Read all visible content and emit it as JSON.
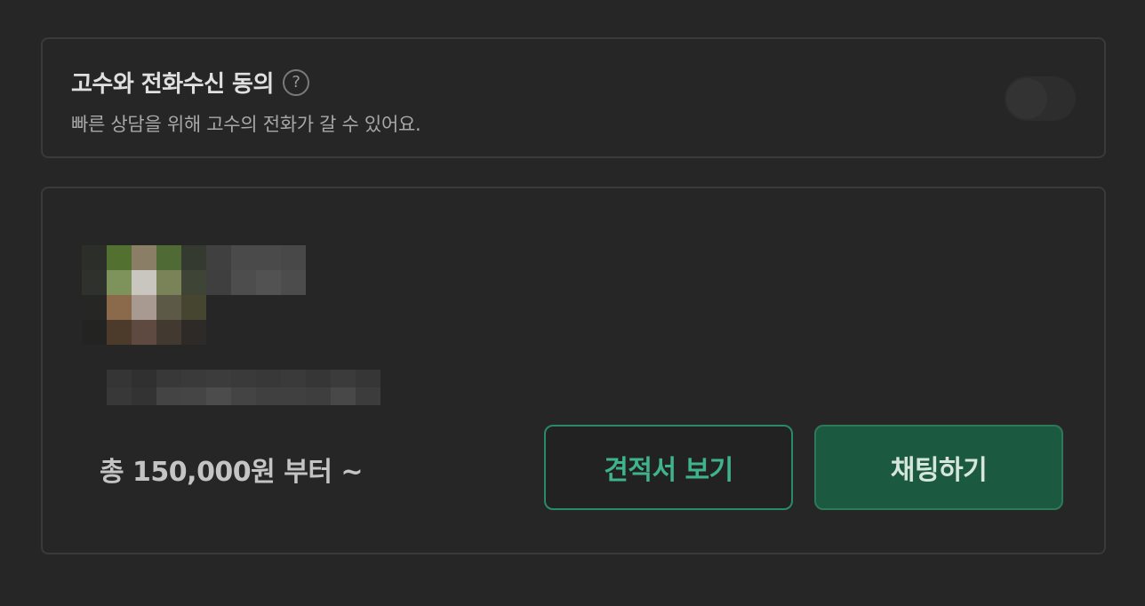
{
  "consent": {
    "title": "고수와 전화수신 동의",
    "help_icon": "?",
    "description": "빠른 상담을 위해 고수의 전화가 갈 수 있어요.",
    "toggle_on": false
  },
  "offer": {
    "price_text": "총 150,000원 부터 ~",
    "quote_button": "견적서 보기",
    "chat_button": "채팅하기"
  },
  "colors": {
    "background": "#262626",
    "accent_green": "#3fb48c",
    "chat_button_bg": "#1b5a40"
  }
}
